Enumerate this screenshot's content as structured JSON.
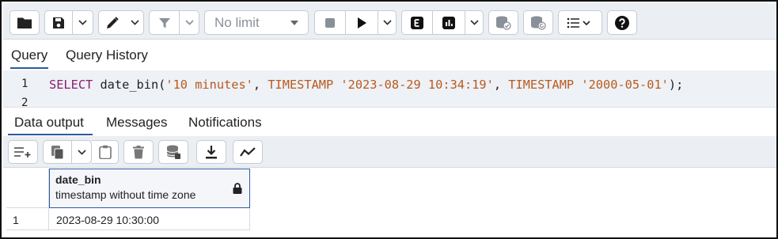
{
  "toolbar": {
    "icons": [
      "folder-icon",
      "save-icon",
      "chevron-down-icon",
      "edit-pen-icon",
      "chevron-down-icon",
      "filter-icon",
      "chevron-down-icon",
      "stop-icon",
      "play-icon",
      "chevron-down-icon",
      "explain-icon",
      "explain-analyze-icon",
      "chevron-down-icon",
      "commit-icon",
      "rollback-icon",
      "macros-list-icon",
      "help-icon"
    ],
    "limit_select": "No limit"
  },
  "query_tabs": [
    {
      "label": "Query",
      "active": true
    },
    {
      "label": "Query History",
      "active": false
    }
  ],
  "editor": {
    "line_numbers": [
      "1",
      "2"
    ],
    "tokens": {
      "kw_select": "SELECT",
      "fn_open": " date_bin(",
      "str_interval": "'10 minutes'",
      "comma1": ", ",
      "kw_ts1": "TIMESTAMP",
      "space1": " ",
      "str_ts1": "'2023-08-29 10:34:19'",
      "comma2": ", ",
      "kw_ts2": "TIMESTAMP",
      "space2": " ",
      "str_ts2": "'2000-05-01'",
      "close": ");"
    }
  },
  "result_tabs": [
    {
      "label": "Data output",
      "active": true
    },
    {
      "label": "Messages",
      "active": false
    },
    {
      "label": "Notifications",
      "active": false
    }
  ],
  "result_toolbar": {
    "icons": [
      "add-row-icon",
      "copy-icon",
      "chevron-down-icon",
      "paste-icon",
      "delete-icon",
      "save-data-icon",
      "download-icon",
      "graph-visualiser-icon"
    ]
  },
  "grid": {
    "columns": [
      {
        "name": "date_bin",
        "type": "timestamp without time zone",
        "icon": "lock-icon"
      }
    ],
    "rows": [
      {
        "num": "1",
        "values": [
          "2023-08-29 10:30:00"
        ]
      }
    ]
  },
  "colors": {
    "toolbar_bg": "#ebeef3",
    "editor_bg": "#eef1f6",
    "keyword": "#8b1e6e",
    "string": "#b85a1e",
    "accent": "#2c5aa0"
  }
}
